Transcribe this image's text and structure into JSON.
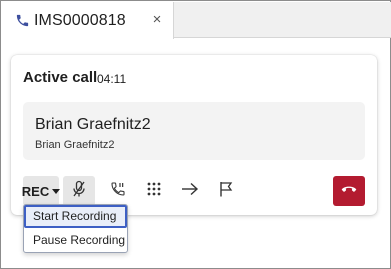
{
  "tab": {
    "label": "IMS0000818",
    "close_label": "×",
    "icon": "phone-icon"
  },
  "call": {
    "title": "Active call",
    "timer": "04:11",
    "caller_name": "Brian Graefnitz2",
    "caller_subtitle": "Brian Graefnitz2"
  },
  "controls": {
    "rec_label": "REC",
    "icons": [
      "mute-microphone-icon",
      "hold-icon",
      "keypad-icon",
      "transfer-arrow-icon",
      "flag-icon",
      "hang-up-icon"
    ]
  },
  "rec_menu": {
    "items": [
      "Start Recording",
      "Pause Recording"
    ]
  },
  "colors": {
    "hangup": "#b31b30",
    "accent_phone": "#3d4f9e",
    "menu_highlight_border": "#3d5fc4"
  }
}
